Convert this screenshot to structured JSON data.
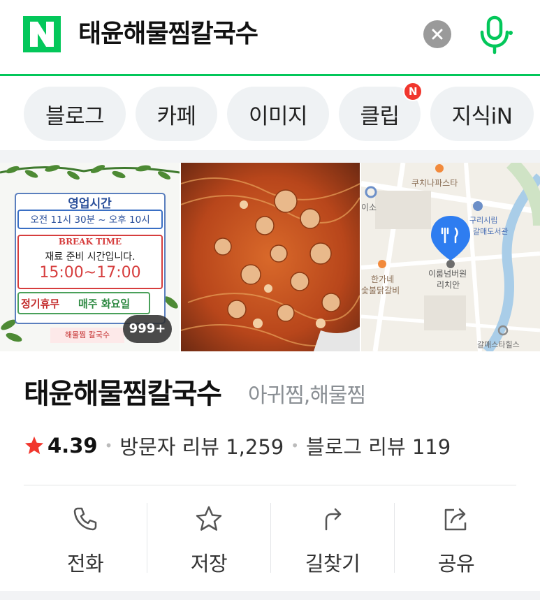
{
  "search": {
    "logo_letter": "N",
    "query": "태윤해물찜칼국수",
    "brand_color": "#03c75a"
  },
  "chips": [
    {
      "label": "블로그",
      "badge": ""
    },
    {
      "label": "카페",
      "badge": ""
    },
    {
      "label": "이미지",
      "badge": ""
    },
    {
      "label": "클립",
      "badge": "N"
    },
    {
      "label": "지식iN",
      "badge": ""
    }
  ],
  "images": {
    "sign": {
      "title": "영업시간",
      "hours": "오전 11시 30분 ~ 오후 10시",
      "break_title": "BREAK TIME",
      "break_note": "재료 준비 시간입니다.",
      "break_hours": "15:00~17:00",
      "closed_prefix": "정기휴무",
      "closed_day": "매주 화요일",
      "logo_text": "해물찜 칼국수",
      "count": "999+"
    },
    "map": {
      "label_1": "쿠치나파스타",
      "label_2": "이소",
      "label_3": "갈매도서관",
      "label_3b": "구리시립",
      "label_4": "한가네",
      "label_4b": "숯불닭갈비",
      "label_5": "이룸넘버원",
      "label_5b": "리치안",
      "label_6": "갈매스타힐스"
    }
  },
  "place": {
    "name": "태윤해물찜칼국수",
    "category": "아귀찜,해물찜",
    "rating": "4.39",
    "visitor_reviews": "방문자 리뷰 1,259",
    "blog_reviews": "블로그 리뷰 119",
    "star_color": "#f1362d"
  },
  "actions": [
    {
      "label": "전화",
      "icon": "phone-icon"
    },
    {
      "label": "저장",
      "icon": "star-icon"
    },
    {
      "label": "길찾기",
      "icon": "directions-icon"
    },
    {
      "label": "공유",
      "icon": "share-icon"
    }
  ]
}
